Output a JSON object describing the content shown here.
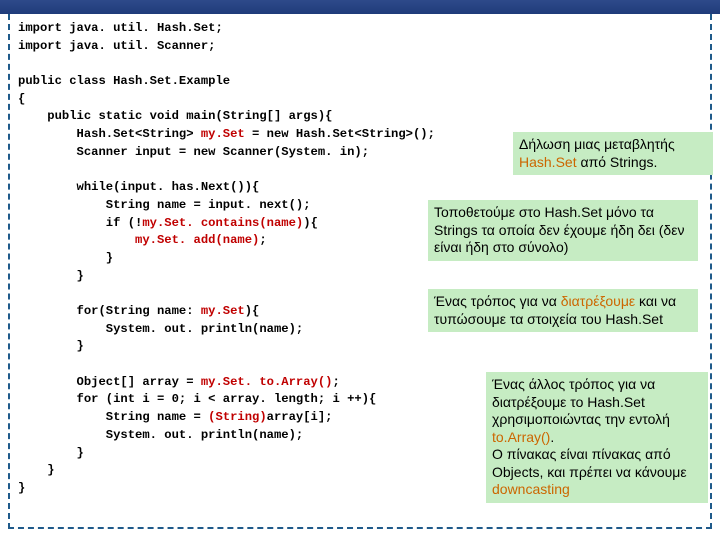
{
  "code": {
    "l1": "import java. util. Hash.Set;",
    "l2": "import java. util. Scanner;",
    "l3": "",
    "l4": "public class Hash.Set.Example",
    "l5": "{",
    "l6": "    public static void main(String[] args){",
    "l7a": "        Hash.Set<String> ",
    "l7b": "my.Set",
    "l7c": " = new Hash.Set<String>();",
    "l8": "        Scanner input = new Scanner(System. in);",
    "l9": "",
    "l10": "        while(input. has.Next()){",
    "l11": "            String name = input. next();",
    "l12a": "            if (!",
    "l12b": "my.Set. contains(name)",
    "l12c": "){",
    "l13a": "                ",
    "l13b": "my.Set. add(name)",
    "l13c": ";",
    "l14": "            }",
    "l15": "        }",
    "l16": "",
    "l17a": "        for(String name: ",
    "l17b": "my.Set",
    "l17c": "){",
    "l18": "            System. out. println(name);",
    "l19": "        }",
    "l20": "",
    "l21a": "        Object[] array = ",
    "l21b": "my.Set. to.Array()",
    "l21c": ";",
    "l22": "        for (int i = 0; i < array. length; i ++){",
    "l23a": "            String name = ",
    "l23b": "(String)",
    "l23c": "array[i];",
    "l24": "            System. out. println(name);",
    "l25": "        }",
    "l26": "    }",
    "l27": "}"
  },
  "callouts": {
    "c1a": "Δήλωση μιας μεταβλητής ",
    "c1b": "Hash.Set",
    "c1c": "  από Strings.",
    "c2": "Τοποθετούμε στο Hash.Set μόνο τα Strings τα οποία δεν έχουμε ήδη δει (δεν είναι ήδη στο σύνολο)",
    "c3a": "Ένας τρόπος για να ",
    "c3b": "διατρέξουμε",
    "c3c": " και να τυπώσουμε τα στοιχεία του Hash.Set",
    "c4a": "Ένας άλλος τρόπος για να διατρέξουμε το Hash.Set χρησιμοποιώντας την εντολή ",
    "c4b": "to.Array()",
    "c4c": ".",
    "c4d": "Ο πίνακας είναι πίνακας από Objects, και πρέπει να κάνουμε ",
    "c4e": "downcasting"
  }
}
